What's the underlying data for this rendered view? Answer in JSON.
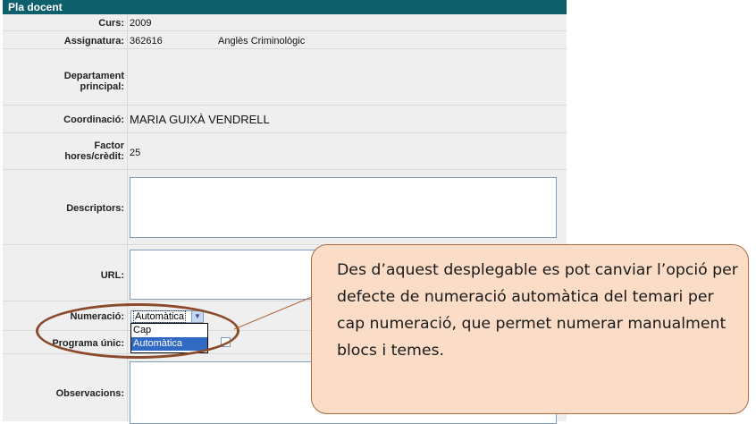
{
  "header": {
    "title": "Pla docent"
  },
  "fields": {
    "curs": {
      "label": "Curs:",
      "value": "2009"
    },
    "assignatura": {
      "label": "Assignatura:",
      "code": "362616",
      "name": "Anglès Criminològic"
    },
    "departament": {
      "label": "Departament principal:",
      "label_line1": "Departament",
      "label_line2": "principal:"
    },
    "coordinacio": {
      "label": "Coordinació:",
      "value": "MARIA GUIXÀ VENDRELL"
    },
    "factor": {
      "label_line1": "Factor",
      "label_line2": "hores/crèdit:",
      "value": "25"
    },
    "descriptors": {
      "label": "Descriptors:",
      "value": ""
    },
    "url": {
      "label": "URL:",
      "value": ""
    },
    "numeracio": {
      "label": "Numeració:",
      "selected": "Automàtica",
      "options": [
        "Cap",
        "Automàtica"
      ]
    },
    "programa": {
      "label": "Programa únic:"
    },
    "observacions": {
      "label": "Observacions:",
      "value": ""
    }
  },
  "callout": {
    "text": "Des d’aquest desplegable es pot canviar l’opció per defecte de numeració automàtica del temari per cap numeració, que permet numerar manualment blocs i temes."
  },
  "colors": {
    "header_bg": "#0e5f6c",
    "callout_bg": "#fbdcc6",
    "highlight_ellipse": "#8a4a2b",
    "selected_option": "#316ac5"
  }
}
